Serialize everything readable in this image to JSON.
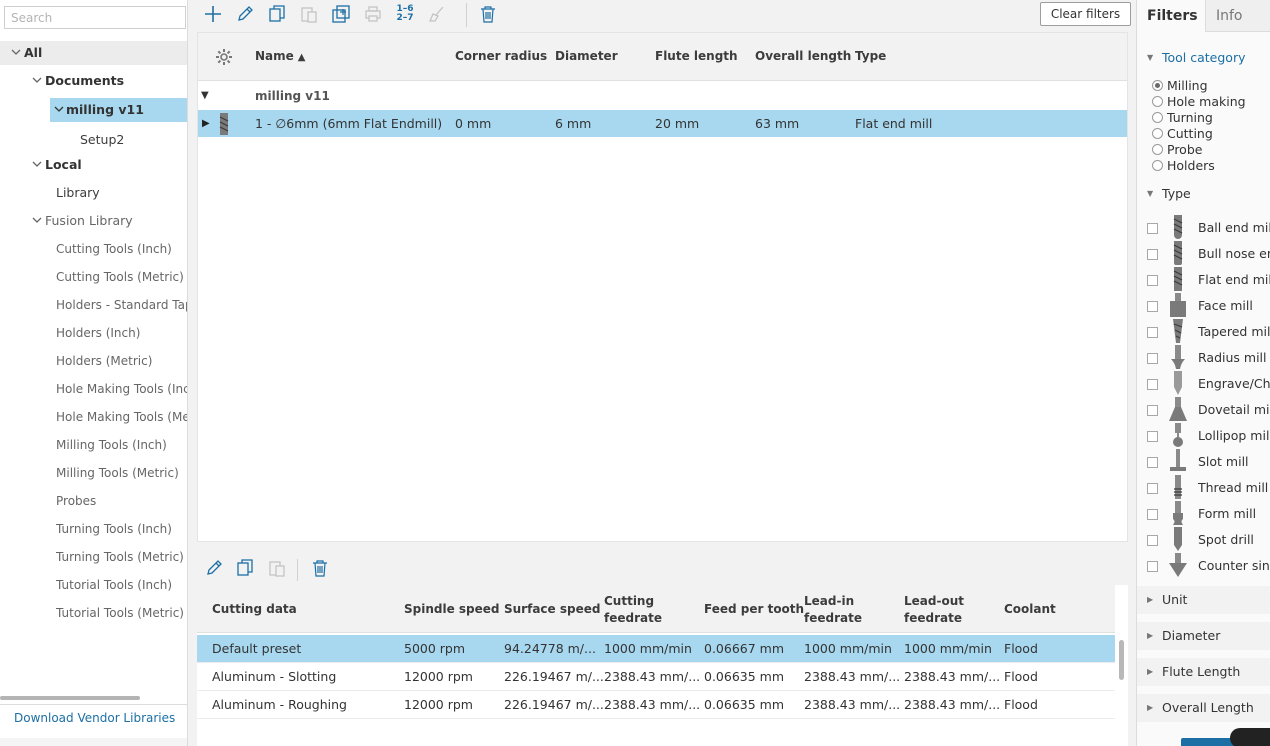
{
  "search": {
    "placeholder": "Search"
  },
  "tree": {
    "all": "All",
    "documents": "Documents",
    "milling": "milling v11",
    "setup": "Setup2",
    "local": "Local",
    "library": "Library",
    "fusion": "Fusion Library",
    "libraries": [
      "Cutting Tools (Inch)",
      "Cutting Tools (Metric)",
      "Holders - Standard Tap",
      "Holders (Inch)",
      "Holders (Metric)",
      "Hole Making Tools (Inc",
      "Hole Making Tools (Met",
      "Milling Tools (Inch)",
      "Milling Tools (Metric)",
      "Probes",
      "Turning Tools (Inch)",
      "Turning Tools (Metric)",
      "Tutorial Tools (Inch)",
      "Tutorial Tools (Metric)"
    ]
  },
  "download_label": "Download Vendor Libraries",
  "toolbar": {
    "clear_filters": "Clear filters",
    "renumber_top": "1–6",
    "renumber_bottom": "2–7"
  },
  "grid": {
    "headers": {
      "name": "Name",
      "corner_radius": "Corner radius",
      "diameter": "Diameter",
      "flute_length": "Flute length",
      "overall_length": "Overall length",
      "type": "Type"
    },
    "group": "milling v11",
    "row": {
      "name": "1 - ∅6mm (6mm Flat Endmill)",
      "corner_radius": "0 mm",
      "diameter": "6 mm",
      "flute_length": "20 mm",
      "overall_length": "63 mm",
      "type": "Flat end mill"
    }
  },
  "cutting": {
    "headers": {
      "cutting_data": "Cutting data",
      "spindle_speed": "Spindle speed",
      "surface_speed": "Surface speed",
      "cutting_feedrate_1": "Cutting",
      "cutting_feedrate_2": "feedrate",
      "feed_per_tooth": "Feed per tooth",
      "leadin_1": "Lead-in",
      "leadin_2": "feedrate",
      "leadout_1": "Lead-out",
      "leadout_2": "feedrate",
      "coolant": "Coolant"
    },
    "rows": [
      {
        "name": "Default preset",
        "spindle": "5000 rpm",
        "surface": "94.24778 m/...",
        "cutting": "1000 mm/min",
        "fpt": "0.06667 mm",
        "leadin": "1000 mm/min",
        "leadout": "1000 mm/min",
        "coolant": "Flood"
      },
      {
        "name": "Aluminum - Slotting",
        "spindle": "12000 rpm",
        "surface": "226.19467 m/...",
        "cutting": "2388.43 mm/...",
        "fpt": "0.06635 mm",
        "leadin": "2388.43 mm/...",
        "leadout": "2388.43 mm/...",
        "coolant": "Flood"
      },
      {
        "name": "Aluminum - Roughing",
        "spindle": "12000 rpm",
        "surface": "226.19467 m/...",
        "cutting": "2388.43 mm/...",
        "fpt": "0.06635 mm",
        "leadin": "2388.43 mm/...",
        "leadout": "2388.43 mm/...",
        "coolant": "Flood"
      }
    ]
  },
  "filters": {
    "tab_filters": "Filters",
    "tab_info": "Info",
    "tool_category": "Tool category",
    "categories": [
      "Milling",
      "Hole making",
      "Turning",
      "Cutting",
      "Probe",
      "Holders"
    ],
    "selected_category": "Milling",
    "type": "Type",
    "types": [
      "Ball end mill",
      "Bull nose end",
      "Flat end mill",
      "Face mill",
      "Tapered mill",
      "Radius mill",
      "Engrave/Char",
      "Dovetail mill",
      "Lollipop mill",
      "Slot mill",
      "Thread mill",
      "Form mill",
      "Spot drill",
      "Counter sink"
    ],
    "sections": [
      "Unit",
      "Diameter",
      "Flute Length",
      "Overall Length"
    ]
  },
  "colors": {
    "accent": "#1c6fa5",
    "selection": "#a8d8ef"
  }
}
